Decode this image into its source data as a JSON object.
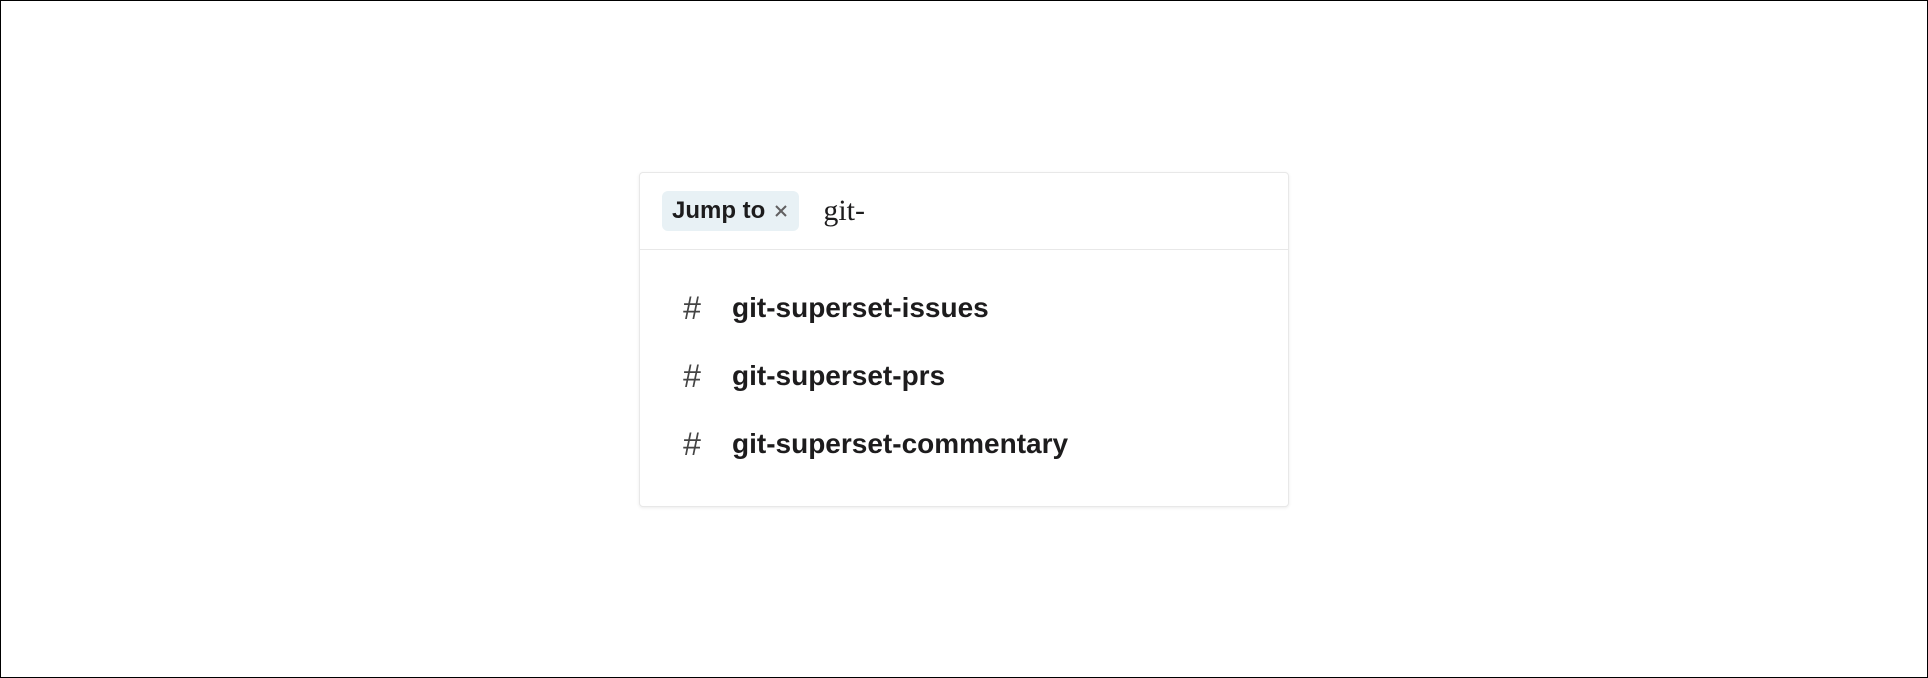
{
  "search": {
    "chip_label": "Jump to",
    "input_value": "git-"
  },
  "results": [
    {
      "icon": "#",
      "label": "git-superset-issues"
    },
    {
      "icon": "#",
      "label": "git-superset-prs"
    },
    {
      "icon": "#",
      "label": "git-superset-commentary"
    }
  ]
}
